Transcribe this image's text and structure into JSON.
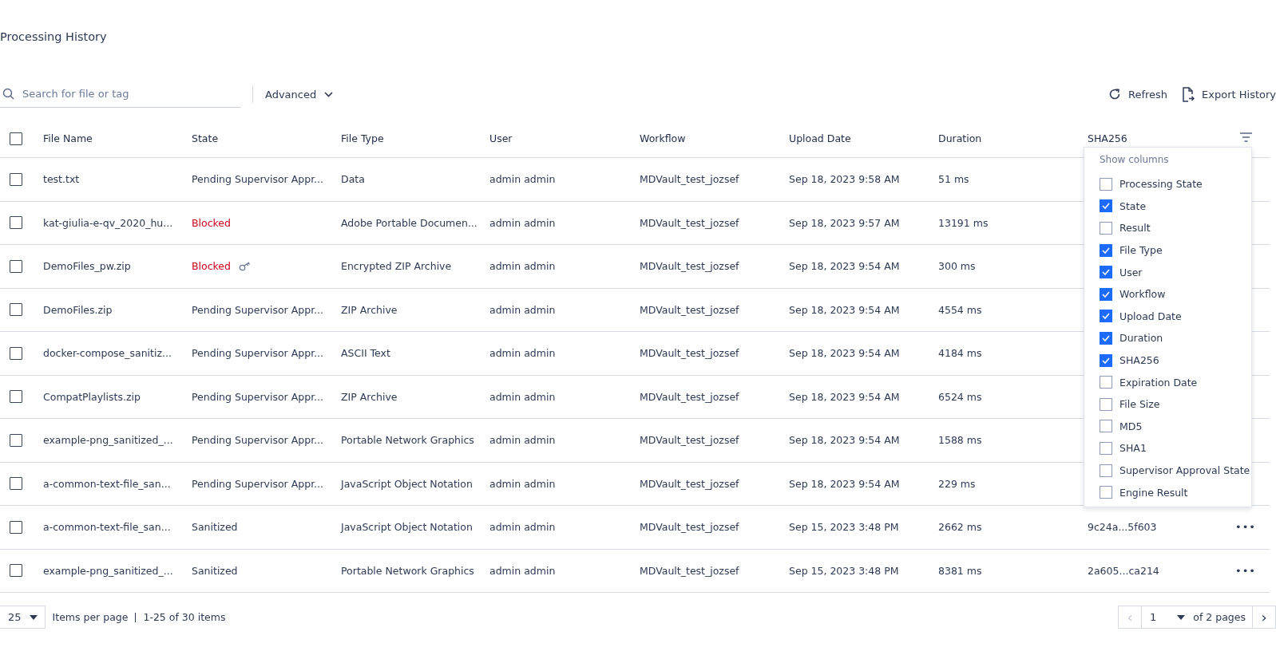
{
  "page_title": "Processing History",
  "toolbar": {
    "search": {
      "placeholder": "Search for file or tag"
    },
    "advanced": "Advanced",
    "refresh": "Refresh",
    "export": "Export History"
  },
  "table": {
    "select_all": {
      "checked": false
    },
    "columns": [
      "File Name",
      "State",
      "File Type",
      "User",
      "Workflow",
      "Upload Date",
      "Duration",
      "SHA256"
    ],
    "rows": [
      {
        "checked": false,
        "file_name": "test.txt",
        "state": "Pending Supervisor Appr...",
        "blocked": false,
        "encrypted": false,
        "file_type": "Data",
        "user": "admin admin",
        "workflow": "MDVault_test_jozsef",
        "upload_date": "Sep 18, 2023 9:58 AM",
        "duration": "51 ms"
      },
      {
        "checked": false,
        "file_name": "kat-giulia-e-qv_2020_hu...",
        "state": "Blocked",
        "blocked": true,
        "encrypted": false,
        "file_type": "Adobe Portable Documen...",
        "user": "admin admin",
        "workflow": "MDVault_test_jozsef",
        "upload_date": "Sep 18, 2023 9:57 AM",
        "duration": "13191 ms"
      },
      {
        "checked": false,
        "file_name": "DemoFiles_pw.zip",
        "state": "Blocked",
        "blocked": true,
        "encrypted": true,
        "file_type": "Encrypted ZIP Archive",
        "user": "admin admin",
        "workflow": "MDVault_test_jozsef",
        "upload_date": "Sep 18, 2023 9:54 AM",
        "duration": "300 ms"
      },
      {
        "checked": false,
        "file_name": "DemoFiles.zip",
        "state": "Pending Supervisor Appr...",
        "blocked": false,
        "encrypted": false,
        "file_type": "ZIP Archive",
        "user": "admin admin",
        "workflow": "MDVault_test_jozsef",
        "upload_date": "Sep 18, 2023 9:54 AM",
        "duration": "4554 ms"
      },
      {
        "checked": false,
        "file_name": "docker-compose_sanitiz...",
        "state": "Pending Supervisor Appr...",
        "blocked": false,
        "encrypted": false,
        "file_type": "ASCII Text",
        "user": "admin admin",
        "workflow": "MDVault_test_jozsef",
        "upload_date": "Sep 18, 2023 9:54 AM",
        "duration": "4184 ms"
      },
      {
        "checked": false,
        "file_name": "CompatPlaylists.zip",
        "state": "Pending Supervisor Appr...",
        "blocked": false,
        "encrypted": false,
        "file_type": "ZIP Archive",
        "user": "admin admin",
        "workflow": "MDVault_test_jozsef",
        "upload_date": "Sep 18, 2023 9:54 AM",
        "duration": "6524 ms"
      },
      {
        "checked": false,
        "file_name": "example-png_sanitized_...",
        "state": "Pending Supervisor Appr...",
        "blocked": false,
        "encrypted": false,
        "file_type": "Portable Network Graphics",
        "user": "admin admin",
        "workflow": "MDVault_test_jozsef",
        "upload_date": "Sep 18, 2023 9:54 AM",
        "duration": "1588 ms"
      },
      {
        "checked": false,
        "file_name": "a-common-text-file_san...",
        "state": "Pending Supervisor Appr...",
        "blocked": false,
        "encrypted": false,
        "file_type": "JavaScript Object Notation",
        "user": "admin admin",
        "workflow": "MDVault_test_jozsef",
        "upload_date": "Sep 18, 2023 9:54 AM",
        "duration": "229 ms"
      },
      {
        "checked": false,
        "file_name": "a-common-text-file_san...",
        "state": "Sanitized",
        "blocked": false,
        "encrypted": false,
        "file_type": "JavaScript Object Notation",
        "user": "admin admin",
        "workflow": "MDVault_test_jozsef",
        "upload_date": "Sep 15, 2023 3:48 PM",
        "duration": "2662 ms",
        "sha256": "9c24a...5f603",
        "more": "•••"
      },
      {
        "checked": false,
        "file_name": "example-png_sanitized_...",
        "state": "Sanitized",
        "blocked": false,
        "encrypted": false,
        "file_type": "Portable Network Graphics",
        "user": "admin admin",
        "workflow": "MDVault_test_jozsef",
        "upload_date": "Sep 15, 2023 3:48 PM",
        "duration": "8381 ms",
        "sha256": "2a605...ca214",
        "more": "•••"
      }
    ]
  },
  "column_menu": {
    "title": "Show columns",
    "items": [
      {
        "label": "Processing State",
        "checked": false
      },
      {
        "label": "State",
        "checked": true
      },
      {
        "label": "Result",
        "checked": false
      },
      {
        "label": "File Type",
        "checked": true
      },
      {
        "label": "User",
        "checked": true
      },
      {
        "label": "Workflow",
        "checked": true
      },
      {
        "label": "Upload Date",
        "checked": true
      },
      {
        "label": "Duration",
        "checked": true
      },
      {
        "label": "SHA256",
        "checked": true
      },
      {
        "label": "Expiration Date",
        "checked": false
      },
      {
        "label": "File Size",
        "checked": false
      },
      {
        "label": "MD5",
        "checked": false
      },
      {
        "label": "SHA1",
        "checked": false
      },
      {
        "label": "Supervisor Approval State",
        "checked": false
      },
      {
        "label": "Engine Result",
        "checked": false
      }
    ]
  },
  "pagination": {
    "page_size": "25",
    "items_per_page": "Items per page",
    "range": "1-25 of 30 items",
    "page": "1",
    "of_pages": "of 2 pages",
    "prev": "‹",
    "next": "›",
    "prev_disabled": true
  }
}
